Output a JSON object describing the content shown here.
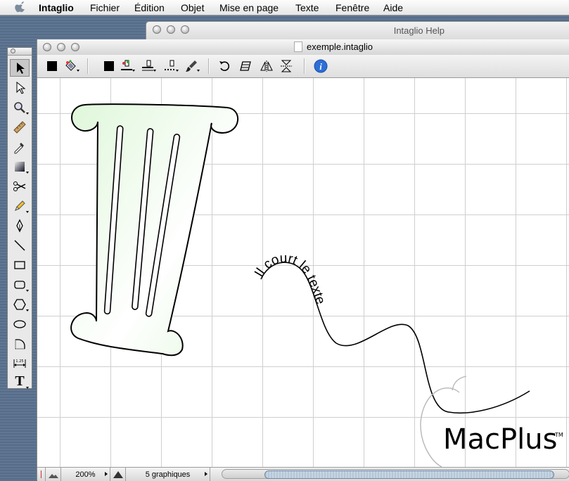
{
  "menubar": {
    "app_name": "Intaglio",
    "items": [
      "Fichier",
      "Édition",
      "Objet",
      "Mise en page",
      "Texte",
      "Fenêtre",
      "Aide"
    ]
  },
  "help_window": {
    "title": "Intaglio Help"
  },
  "document_window": {
    "title": "exemple.intaglio"
  },
  "palette_tools": [
    "arrow-tool",
    "direct-select-tool",
    "zoom-tool",
    "ruler-tool",
    "eyedropper-tool",
    "gradient-tool",
    "scissors-tool",
    "pencil-tool",
    "pen-tool",
    "line-tool",
    "rectangle-tool",
    "rounded-rectangle-tool",
    "polygon-tool",
    "oval-tool",
    "arc-tool",
    "dimension-tool",
    "text-tool"
  ],
  "palette_dimension_label": "1.25",
  "palette_text_glyph": "T",
  "toolbar_icons": [
    "fill-color-icon",
    "paint-bucket-icon",
    "stroke-color-icon",
    "stroke-style-icon",
    "line-width-icon",
    "dash-icon",
    "brush-icon",
    "rotate-icon",
    "skew-icon",
    "flip-horizontal-icon",
    "flip-vertical-icon",
    "info-icon"
  ],
  "canvas": {
    "curved_text": "Il court le texte",
    "logo_text": "MacPlus",
    "logo_trademark": "TM"
  },
  "status": {
    "zoom": "200%",
    "selection": "5 graphiques"
  },
  "colors": {
    "column_fill": "#e6f9e3",
    "info_blue": "#2d6fd6",
    "grid": "#cfcfcf"
  }
}
